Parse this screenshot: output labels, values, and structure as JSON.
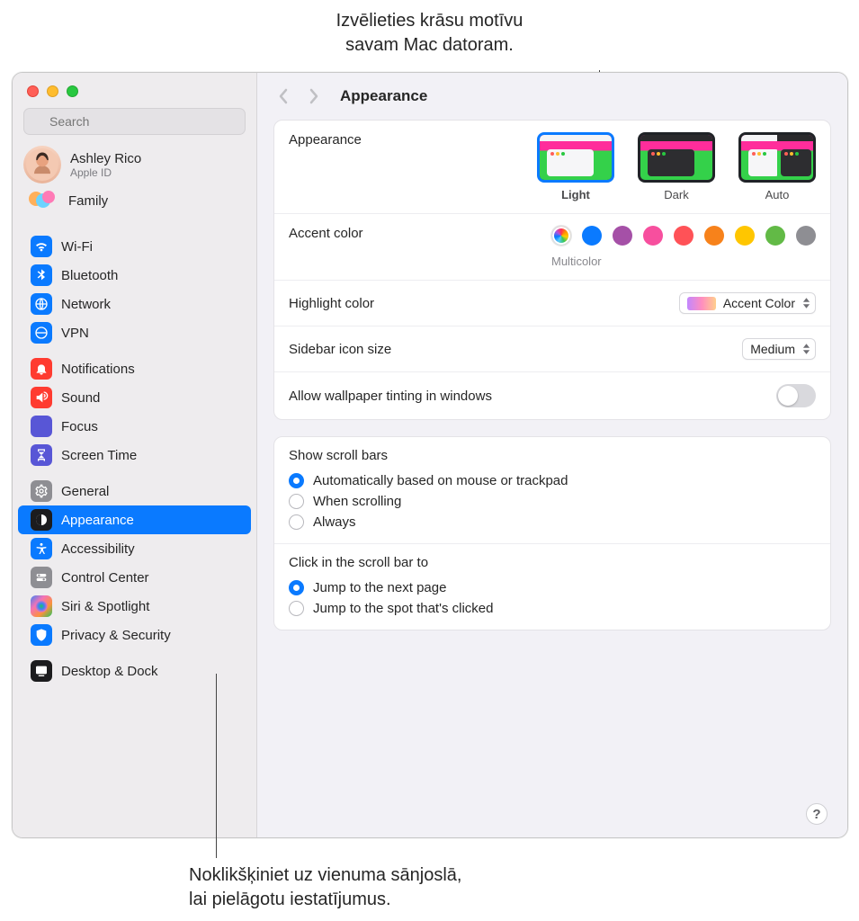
{
  "callouts": {
    "top_line1": "Izvēlieties krāsu motīvu",
    "top_line2": "savam Mac datoram.",
    "bottom_line1": "Noklikšķiniet uz vienuma sānjoslā,",
    "bottom_line2": "lai pielāgotu iestatījumus."
  },
  "window": {
    "search_placeholder": "Search",
    "account": {
      "name": "Ashley Rico",
      "sub": "Apple ID",
      "family": "Family"
    },
    "sidebar_groups": [
      {
        "items": [
          {
            "key": "wifi",
            "label": "Wi-Fi",
            "color": "ic-blue"
          },
          {
            "key": "bluetooth",
            "label": "Bluetooth",
            "color": "ic-blue"
          },
          {
            "key": "network",
            "label": "Network",
            "color": "ic-blue"
          },
          {
            "key": "vpn",
            "label": "VPN",
            "color": "ic-blue"
          }
        ]
      },
      {
        "items": [
          {
            "key": "notifications",
            "label": "Notifications",
            "color": "ic-red"
          },
          {
            "key": "sound",
            "label": "Sound",
            "color": "ic-red"
          },
          {
            "key": "focus",
            "label": "Focus",
            "color": "ic-indigo"
          },
          {
            "key": "screentime",
            "label": "Screen Time",
            "color": "ic-indigo"
          }
        ]
      },
      {
        "items": [
          {
            "key": "general",
            "label": "General",
            "color": "ic-gray"
          },
          {
            "key": "appearance",
            "label": "Appearance",
            "color": "ic-black",
            "selected": true
          },
          {
            "key": "accessibility",
            "label": "Accessibility",
            "color": "ic-blue"
          },
          {
            "key": "controlcenter",
            "label": "Control Center",
            "color": "ic-gray"
          },
          {
            "key": "siri",
            "label": "Siri & Spotlight",
            "color": "ic-grad"
          },
          {
            "key": "privacy",
            "label": "Privacy & Security",
            "color": "ic-blue"
          }
        ]
      },
      {
        "items": [
          {
            "key": "desktopdock",
            "label": "Desktop & Dock",
            "color": "ic-black"
          }
        ]
      }
    ],
    "header_title": "Appearance",
    "appearance": {
      "label": "Appearance",
      "options": {
        "light": "Light",
        "dark": "Dark",
        "auto": "Auto"
      },
      "selected": "light"
    },
    "accent": {
      "label": "Accent color",
      "selected_name": "Multicolor",
      "colors": [
        "multi",
        "#0a7aff",
        "#a550a7",
        "#f74f9e",
        "#ff5257",
        "#f7821b",
        "#ffc600",
        "#62ba46",
        "#8e8e93"
      ]
    },
    "highlight": {
      "label": "Highlight color",
      "value": "Accent Color"
    },
    "sidebar_icon": {
      "label": "Sidebar icon size",
      "value": "Medium"
    },
    "tinting": {
      "label": "Allow wallpaper tinting in windows",
      "on": false
    },
    "scrollbars": {
      "title": "Show scroll bars",
      "opts": [
        "Automatically based on mouse or trackpad",
        "When scrolling",
        "Always"
      ],
      "selected": 0
    },
    "scrollclick": {
      "title": "Click in the scroll bar to",
      "opts": [
        "Jump to the next page",
        "Jump to the spot that's clicked"
      ],
      "selected": 0
    },
    "help": "?"
  }
}
